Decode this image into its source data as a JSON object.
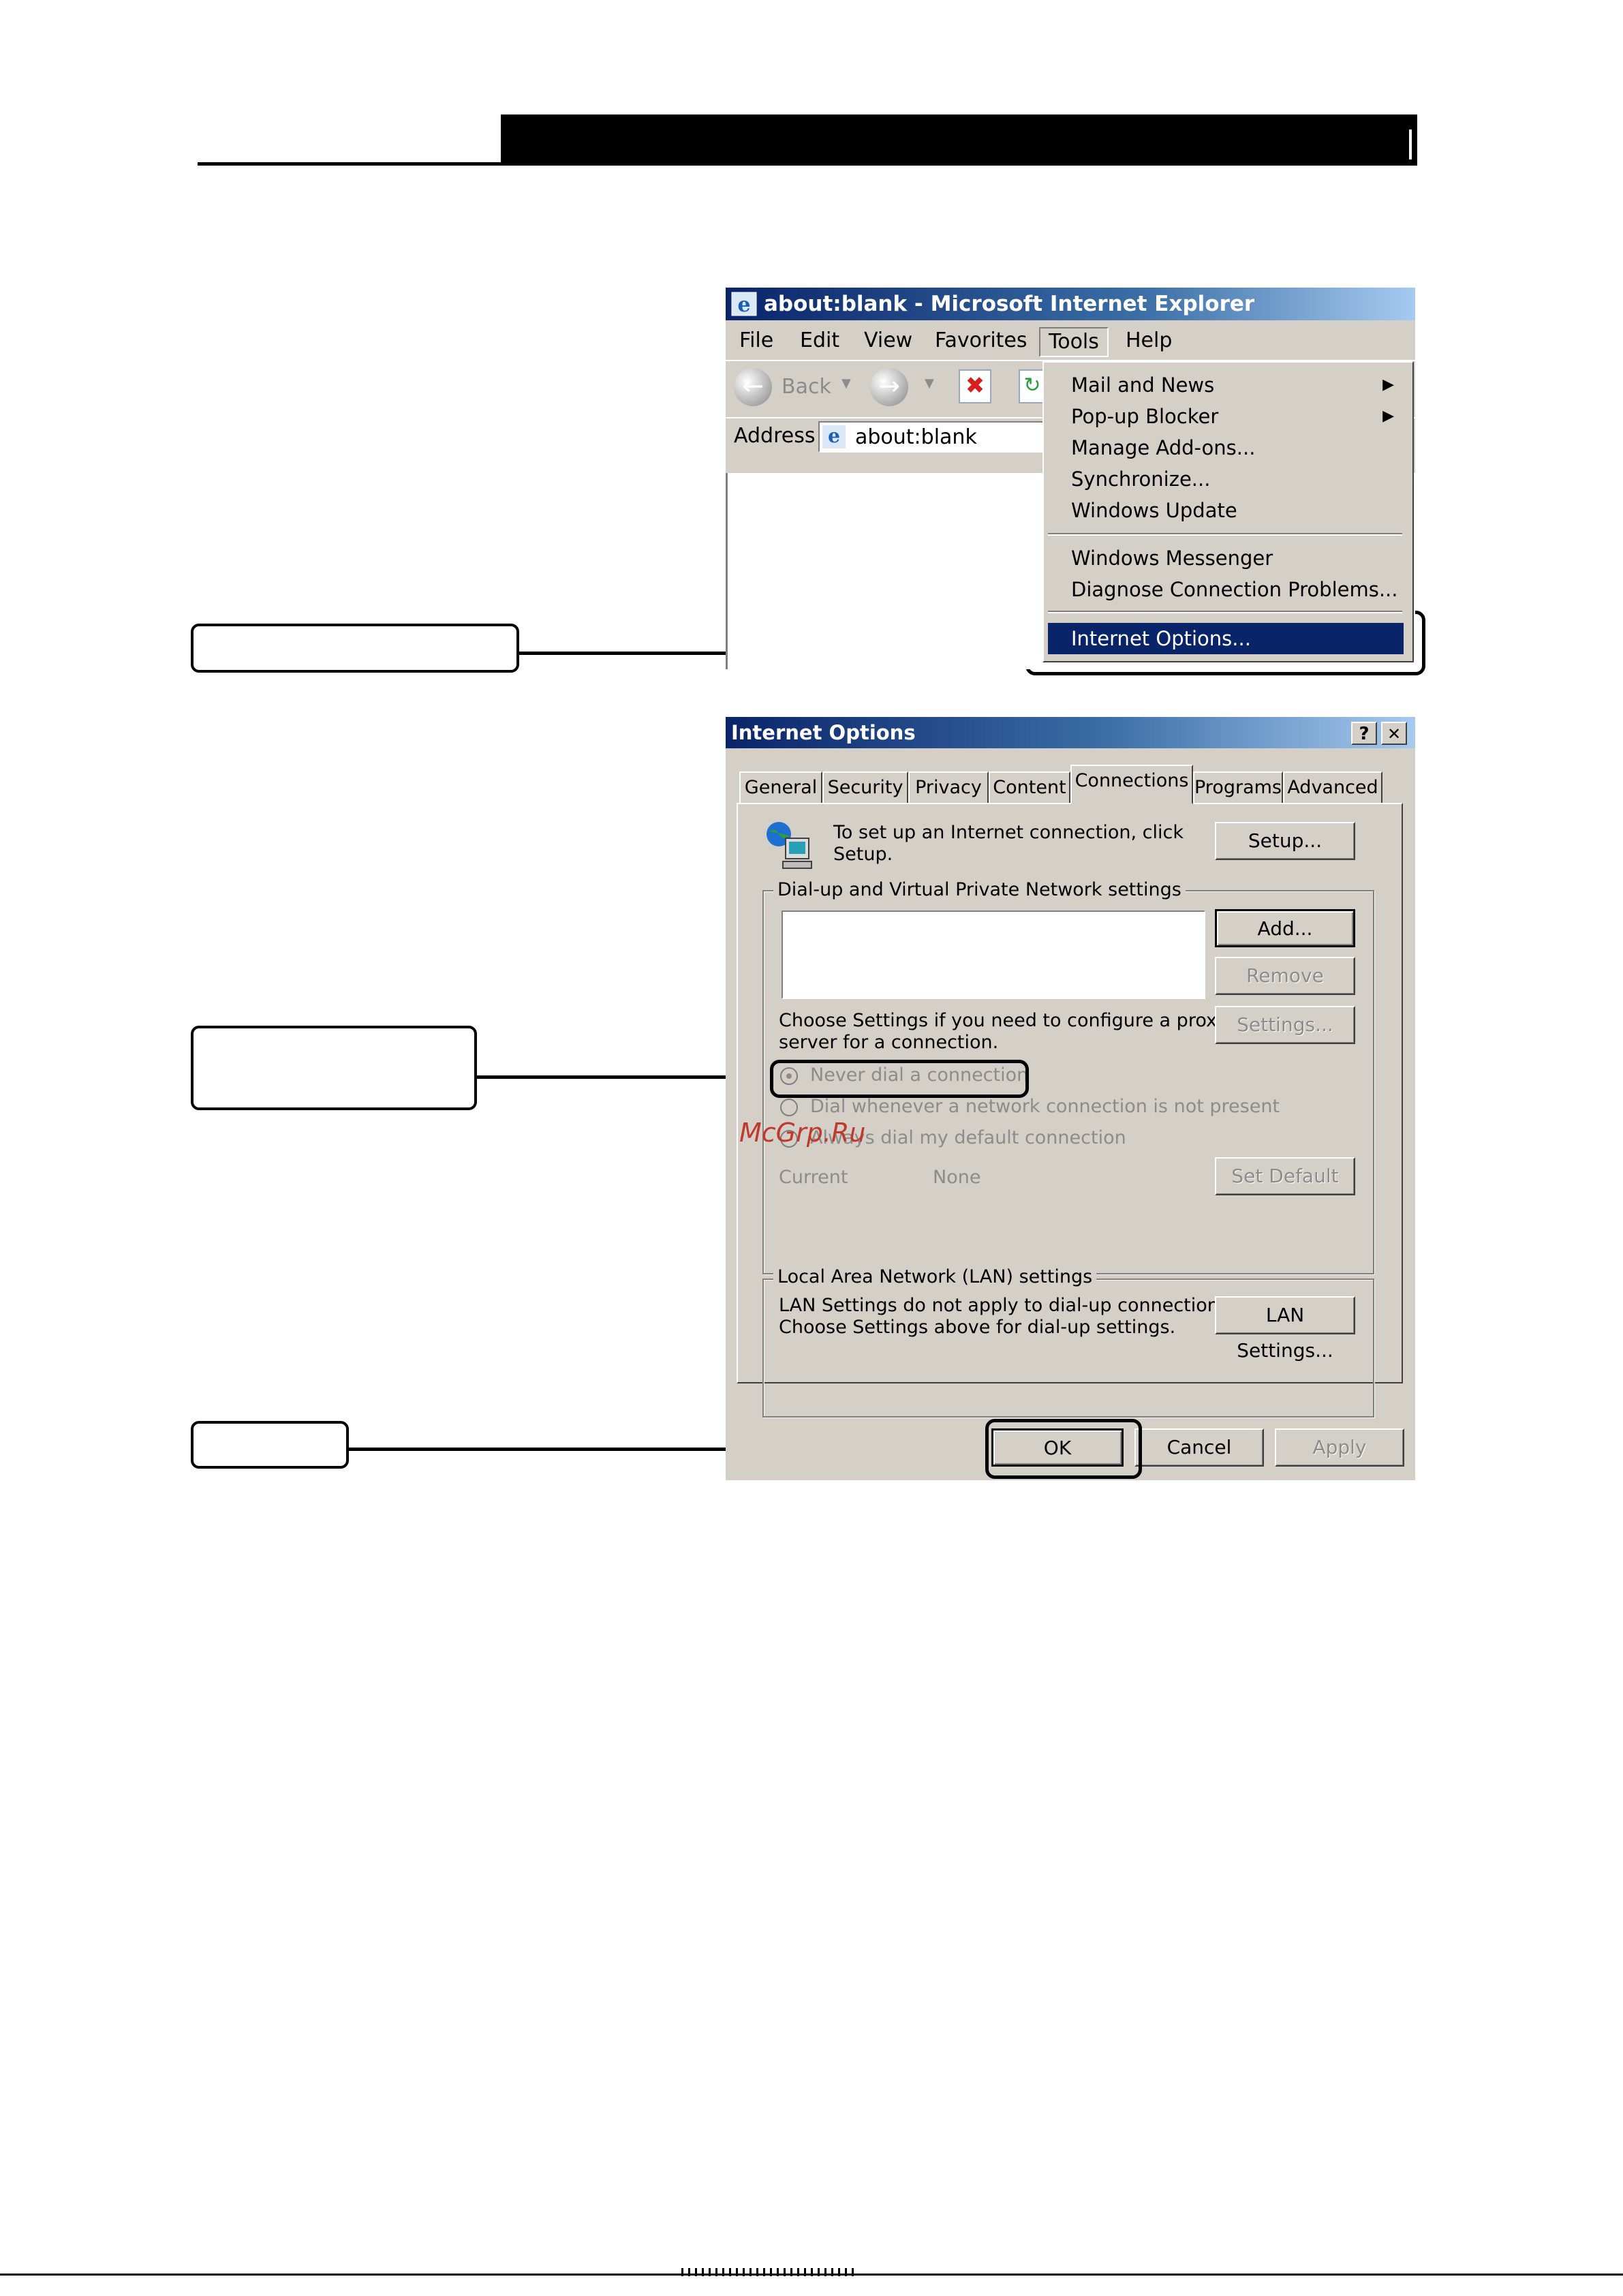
{
  "ie_window": {
    "title": "about:blank - Microsoft Internet Explorer",
    "menu": [
      "File",
      "Edit",
      "View",
      "Favorites",
      "Tools",
      "Help"
    ],
    "toolbar": {
      "back_label": "Back"
    },
    "address": {
      "label": "Address",
      "value": "about:blank"
    },
    "tools_menu": {
      "items": [
        {
          "label": "Mail and News",
          "submenu": true
        },
        {
          "label": "Pop-up Blocker",
          "submenu": true
        },
        {
          "label": "Manage Add-ons...",
          "submenu": false
        },
        {
          "label": "Synchronize...",
          "submenu": false
        },
        {
          "label": "Windows Update",
          "submenu": false
        },
        {
          "label": "Windows Messenger",
          "submenu": false
        },
        {
          "label": "Diagnose Connection Problems...",
          "submenu": false
        },
        {
          "label": "Internet Options...",
          "submenu": false,
          "highlighted": true
        }
      ]
    }
  },
  "dialog": {
    "title": "Internet Options",
    "help_btn": "?",
    "close_btn": "✕",
    "tabs": [
      "General",
      "Security",
      "Privacy",
      "Content",
      "Connections",
      "Programs",
      "Advanced"
    ],
    "active_tab": "Connections",
    "setup_text_1": "To set up an Internet connection, click",
    "setup_text_2": "Setup.",
    "setup_button": "Setup...",
    "dialup_group_label": "Dial-up and Virtual Private Network settings",
    "add_button": "Add...",
    "remove_button": "Remove",
    "settings_text_1": "Choose Settings if you need to configure a proxy",
    "settings_text_2": "server for a connection.",
    "settings_button": "Settings...",
    "radio_never": "Never dial a connection",
    "radio_whenever": "Dial whenever a network connection is not present",
    "radio_always": "Always dial my default connection",
    "current_label": "Current",
    "current_value": "None",
    "set_default_button": "Set Default",
    "lan_group_label": "Local Area Network (LAN) settings",
    "lan_text_1": "LAN Settings do not apply to dial-up connections.",
    "lan_text_2": "Choose Settings above for dial-up settings.",
    "lan_settings_button": "LAN Settings...",
    "ok_button": "OK",
    "cancel_button": "Cancel",
    "apply_button": "Apply"
  },
  "watermark": "McGrp.Ru",
  "colors": {
    "title_bar": "#0a246a",
    "face": "#d4d0c8",
    "watermark": "#c0392b"
  }
}
